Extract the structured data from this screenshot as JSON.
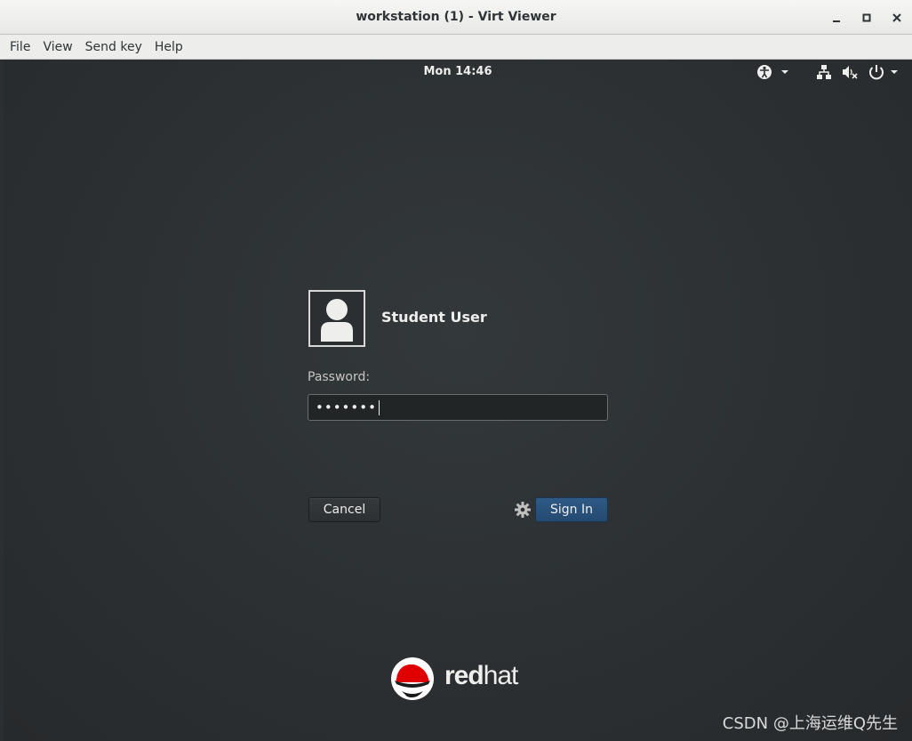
{
  "window": {
    "title": "workstation (1) - Virt Viewer",
    "minimize_icon": "minimize-icon",
    "maximize_icon": "maximize-icon",
    "close_icon": "close-icon"
  },
  "menubar": {
    "items": [
      {
        "label": "File"
      },
      {
        "label": "View"
      },
      {
        "label": "Send key"
      },
      {
        "label": "Help"
      }
    ]
  },
  "topbar": {
    "clock": "Mon 14:46",
    "icons": [
      "accessibility-icon",
      "network-icon",
      "volume-muted-icon",
      "power-icon"
    ]
  },
  "login": {
    "user_name": "Student User",
    "password_label": "Password:",
    "password_mask": "•••••••",
    "cancel_label": "Cancel",
    "signin_label": "Sign In",
    "session_icon": "gear-icon"
  },
  "branding": {
    "logo_bold": "red",
    "logo_light": "hat",
    "logo_color": "#e00000"
  },
  "watermark": "CSDN @上海运维Q先生",
  "colors": {
    "background": "#2b2f31",
    "accent": "#2e5a86",
    "text": "#eeeeec"
  }
}
